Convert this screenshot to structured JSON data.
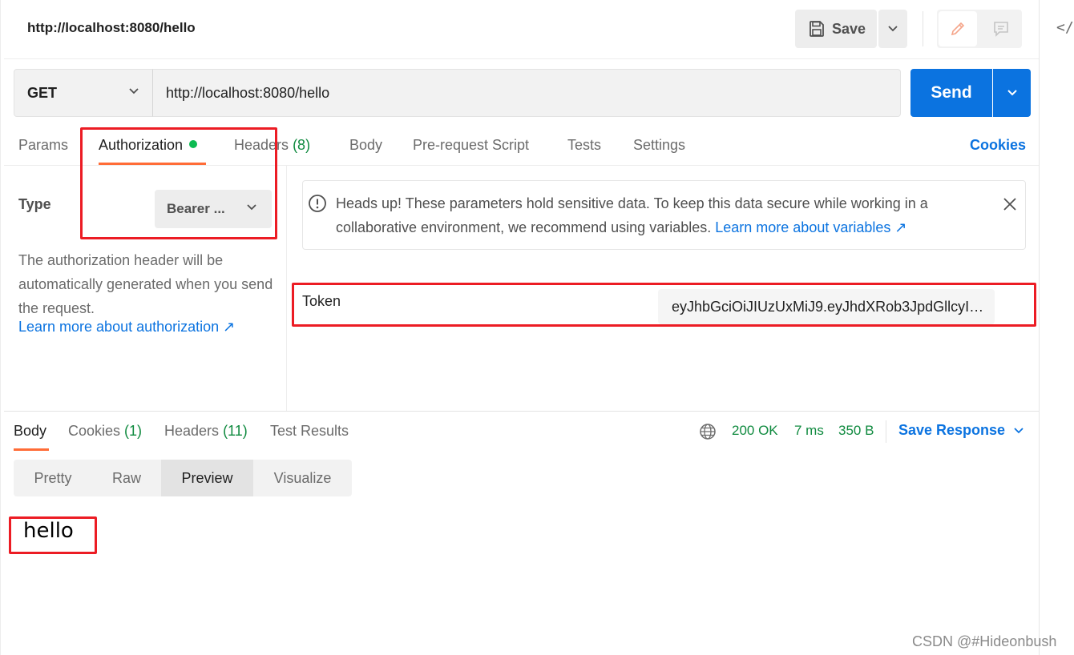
{
  "header": {
    "tab_title": "http://localhost:8080/hello",
    "save_label": "Save"
  },
  "request": {
    "method": "GET",
    "url": "http://localhost:8080/hello",
    "send_label": "Send"
  },
  "request_tabs": [
    {
      "label": "Params"
    },
    {
      "label": "Authorization",
      "active": true,
      "indicator": "green-dot"
    },
    {
      "label": "Headers",
      "count": "(8)"
    },
    {
      "label": "Body"
    },
    {
      "label": "Pre-request Script"
    },
    {
      "label": "Tests"
    },
    {
      "label": "Settings"
    }
  ],
  "cookies_link": "Cookies",
  "auth": {
    "type_label": "Type",
    "type_value": "Bearer ...",
    "description": "The authorization header will be automatically generated when you send the request.",
    "learn_more": "Learn more about authorization ↗",
    "notice_text": "Heads up! These parameters hold sensitive data. To keep this data secure while working in a collaborative environment, we recommend using variables.",
    "notice_link": "Learn more about variables ↗",
    "token_label": "Token",
    "token_value": "eyJhbGciOiJIUzUxMiJ9.eyJhdXRob3JpdGllcyI6..."
  },
  "response": {
    "tabs": [
      {
        "label": "Body",
        "active": true
      },
      {
        "label": "Cookies",
        "count": "(1)"
      },
      {
        "label": "Headers",
        "count": "(11)"
      },
      {
        "label": "Test Results"
      }
    ],
    "status": "200 OK",
    "time": "7 ms",
    "size": "350 B",
    "save_response": "Save Response",
    "view_modes": [
      "Pretty",
      "Raw",
      "Preview",
      "Visualize"
    ],
    "active_view": "Preview",
    "body_text": "hello"
  },
  "colors": {
    "accent": "#0b73e0",
    "tab_underline": "#ff6c37",
    "success": "#0f8a3f",
    "annotation": "#ec1c24"
  },
  "watermark": "CSDN @#Hideonbush",
  "side_panel_icon": "</>"
}
